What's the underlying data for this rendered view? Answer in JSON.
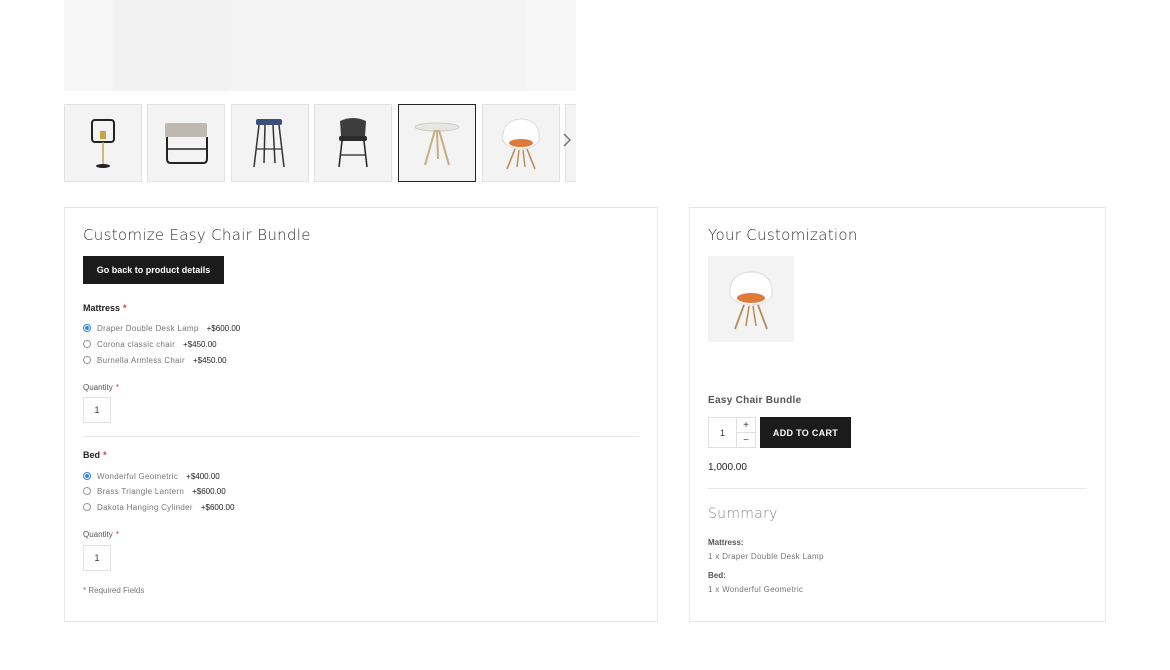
{
  "gallery": {
    "thumbnails": [
      {
        "icon": "lamp-icon"
      },
      {
        "icon": "bench-icon"
      },
      {
        "icon": "bar-stool-icon"
      },
      {
        "icon": "dark-stool-icon"
      },
      {
        "icon": "round-table-icon"
      },
      {
        "icon": "easy-chair-icon"
      }
    ],
    "active_index": 4
  },
  "customize": {
    "title": "Customize Easy Chair Bundle",
    "back_label": "Go back to product details",
    "groups": [
      {
        "label": "Mattress",
        "required_mark": "*",
        "options": [
          {
            "name": "Draper Double Desk Lamp",
            "price": "+$600.00",
            "selected": true
          },
          {
            "name": "Corona classic chair",
            "price": "+$450.00",
            "selected": false
          },
          {
            "name": "Burnella Armless Chair",
            "price": "+$450.00",
            "selected": false
          }
        ],
        "quantity_label": "Quantity",
        "quantity": "1"
      },
      {
        "label": "Bed",
        "required_mark": "*",
        "options": [
          {
            "name": "Wonderful Geometric",
            "price": "+$400.00",
            "selected": true
          },
          {
            "name": "Brass Triangle Lantern",
            "price": "+$600.00",
            "selected": false
          },
          {
            "name": "Dakota Hanging Cylinder",
            "price": "+$600.00",
            "selected": false
          }
        ],
        "quantity_label": "Quantity",
        "quantity": "1"
      }
    ],
    "required_note": "* Required Fields"
  },
  "your_customization": {
    "title": "Your Customization",
    "product_name": "Easy Chair Bundle",
    "cart_qty": "1",
    "plus": "+",
    "minus": "−",
    "add_to_cart": "ADD TO CART",
    "total": "1,000.00",
    "summary_title": "Summary",
    "summary": [
      {
        "label": "Mattress:",
        "value": "1 x Draper Double Desk Lamp"
      },
      {
        "label": "Bed:",
        "value": "1 x Wonderful Geometric"
      }
    ]
  }
}
